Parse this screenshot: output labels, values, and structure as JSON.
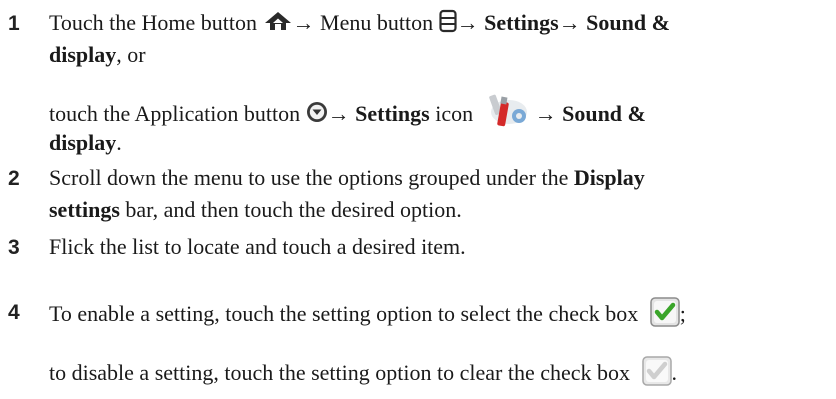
{
  "steps": [
    {
      "number": "1",
      "line1": {
        "t1": "Touch the Home button",
        "arrow1": "→",
        "t2": "Menu button",
        "arrow2": "→",
        "settings": "Settings",
        "arrow3": "→",
        "sound": "Sound &"
      },
      "line2": {
        "display": "display",
        "tail": ", or"
      },
      "line3": {
        "t1": "touch the Application button",
        "arrow1": "→",
        "settings": "Settings",
        "t2": " icon",
        "arrow2": "→",
        "sound": "Sound &"
      },
      "line4": {
        "display": "display",
        "tail": "."
      }
    },
    {
      "number": "2",
      "line1": {
        "t1": "Scroll down the menu to use the options grouped under the ",
        "bold": "Display"
      },
      "line2": {
        "bold": "settings",
        "tail": " bar, and then touch the desired option."
      }
    },
    {
      "number": "3",
      "line1": {
        "t1": "Flick the list to locate and touch a desired item."
      }
    },
    {
      "number": "4",
      "line1": {
        "t1": "To enable a setting, touch the setting option to select the check box",
        "tail": ";"
      },
      "line2": {
        "t1": "to disable a setting, touch the setting option to clear the check box",
        "tail": "."
      }
    }
  ],
  "icons": {
    "home": "home-icon",
    "menu": "menu-icon",
    "application": "application-button-icon",
    "settings": "settings-icon",
    "checked": "checkbox-checked-icon",
    "unchecked": "checkbox-unchecked-icon"
  },
  "colors": {
    "check_green": "#3aa52a",
    "text": "#1a1a1a",
    "settings_red": "#d42a2a"
  }
}
